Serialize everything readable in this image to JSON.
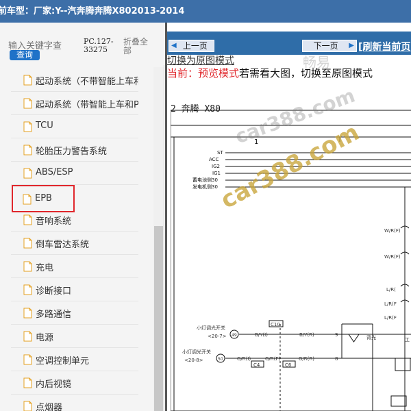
{
  "titlebar": {
    "text": "前车型：厂家:Y--汽奔腾奔腾X802013-2014"
  },
  "left_panel": {
    "search": {
      "placeholder": "输入关键字查",
      "button": "查询"
    },
    "code": "PC.127-33275",
    "collapse_all": "折叠全部"
  },
  "tree": [
    {
      "label": "起动系统（不带智能上车和PK"
    },
    {
      "label": "起动系统（带智能上车和PKE系"
    },
    {
      "label": "TCU"
    },
    {
      "label": "轮胎压力警告系统"
    },
    {
      "label": "ABS/ESP"
    },
    {
      "label": "EPB"
    },
    {
      "label": "音响系统"
    },
    {
      "label": "倒车雷达系统"
    },
    {
      "label": "充电"
    },
    {
      "label": "诊断接口"
    },
    {
      "label": "多路通信"
    },
    {
      "label": "电源"
    },
    {
      "label": "空调控制单元"
    },
    {
      "label": "内后视镜"
    },
    {
      "label": "点烟器"
    }
  ],
  "toolbar": {
    "prev": "上一页",
    "next": "下一页",
    "refresh": "[刷新当前页"
  },
  "viewer": {
    "switch_link": "切换为原图模式",
    "mode_prefix": "当前：",
    "mode_name": "预览模式",
    "mode_hint": "若需看大图，切换至原图模式"
  },
  "diagram": {
    "title": "2 奔腾 X80",
    "ruler_number": "1",
    "signals": [
      "ST",
      "ACC",
      "IG2",
      "IG1",
      "蓄电池侧30",
      "发电机侧30"
    ],
    "wire_labels": [
      "W/R(F)",
      "W/R(F)",
      "L/R(",
      "L/R(F",
      "L/R(F"
    ],
    "connectors": [
      "C10",
      "C4",
      "C6"
    ],
    "switch1": {
      "name": "小灯调光开关",
      "pin": "<20-7>",
      "node": "49",
      "wire1": "B/Y(I)",
      "wire2": "B/Y(R)",
      "pin_num": "9"
    },
    "switch2": {
      "name": "小灯调光开关",
      "pin": "<20-8>",
      "node": "50",
      "wire1": "G/R(I)",
      "wire2": "G/R(F)",
      "wire3": "G/R(R)",
      "pin_num": "8"
    },
    "backlight": "背光",
    "side_text": "工"
  },
  "watermark": {
    "line1": "畅易",
    "line2": "car388.com",
    "line3": "car388.com"
  },
  "colors": {
    "titlebar": "#3d6fa8",
    "nav": "#2f6da8",
    "selected_border": "#e0262b",
    "search_button": "#1f72c8",
    "mode_red": "#e0262b"
  }
}
